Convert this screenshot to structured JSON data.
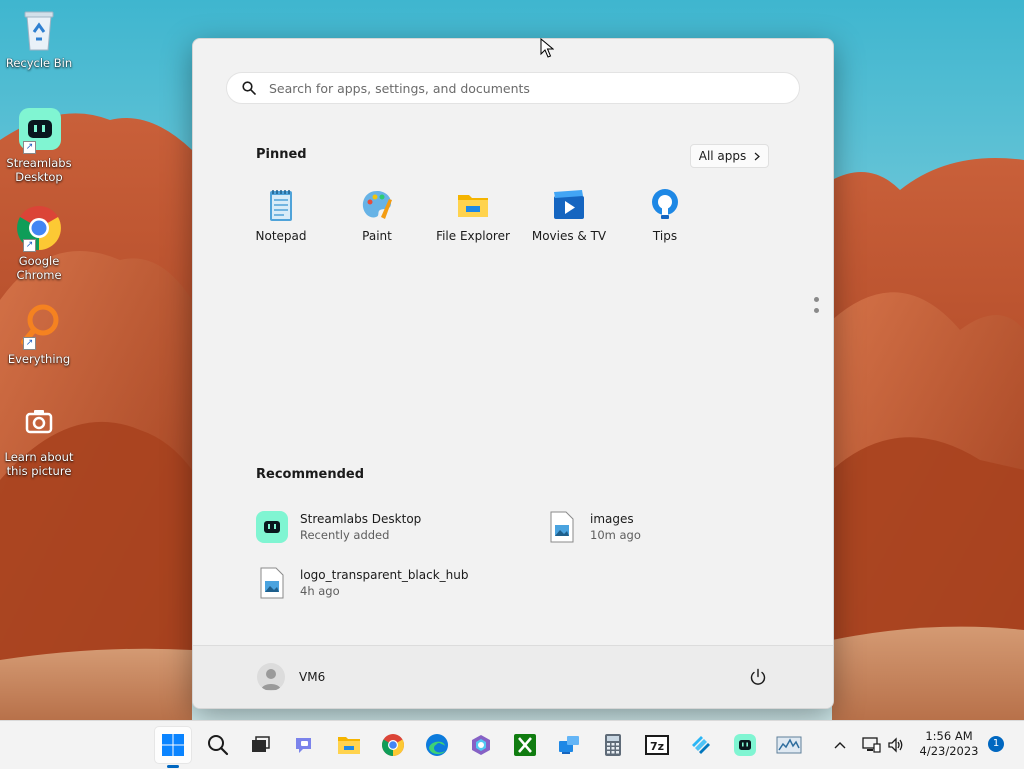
{
  "desktop": {
    "icons": [
      {
        "label": "Recycle Bin"
      },
      {
        "label": "Streamlabs Desktop"
      },
      {
        "label": "Google Chrome"
      },
      {
        "label": "Everything"
      },
      {
        "label": "Learn about this picture"
      }
    ]
  },
  "start_menu": {
    "search": {
      "placeholder": "Search for apps, settings, and documents"
    },
    "pinned": {
      "title": "Pinned",
      "all_apps_label": "All apps",
      "apps": [
        {
          "label": "Notepad",
          "icon": "notepad-icon"
        },
        {
          "label": "Paint",
          "icon": "paint-icon"
        },
        {
          "label": "File Explorer",
          "icon": "file-explorer-icon"
        },
        {
          "label": "Movies & TV",
          "icon": "movies-tv-icon"
        },
        {
          "label": "Tips",
          "icon": "tips-icon"
        }
      ]
    },
    "recommended": {
      "title": "Recommended",
      "items": [
        {
          "name": "Streamlabs Desktop",
          "sub": "Recently added",
          "icon": "streamlabs-icon"
        },
        {
          "name": "images",
          "sub": "10m ago",
          "icon": "image-file-icon"
        },
        {
          "name": "logo_transparent_black_hub",
          "sub": "4h ago",
          "icon": "image-file-icon"
        }
      ]
    },
    "footer": {
      "user_name": "VM6"
    }
  },
  "taskbar": {
    "apps": [
      "start-icon",
      "search-icon",
      "task-view-icon",
      "teams-chat-icon",
      "file-explorer-icon",
      "chrome-icon",
      "edge-icon",
      "copilot-icon",
      "xbox-icon",
      "remote-desktop-icon",
      "calculator-icon",
      "7zip-icon",
      "tiles-app-icon",
      "streamlabs-icon",
      "resource-monitor-icon"
    ],
    "tray": {
      "time": "1:56 AM",
      "date": "4/23/2023",
      "notification_count": "1"
    }
  },
  "colors": {
    "accent": "#0067c0",
    "start_bg": "#f2f2f2",
    "taskbar_bg": "#f3f3f3"
  }
}
